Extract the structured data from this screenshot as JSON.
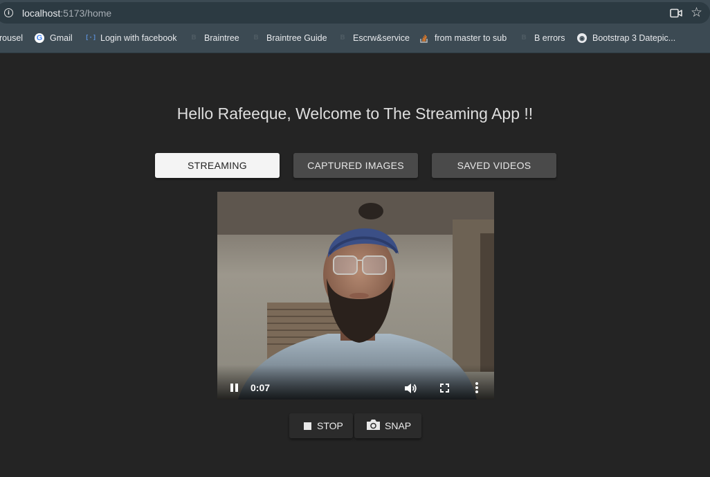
{
  "browser": {
    "url_host": "localhost",
    "url_path": ":5173/home",
    "bookmarks": [
      {
        "label": "rousel",
        "icon": "none"
      },
      {
        "label": "Gmail",
        "icon": "google-icon"
      },
      {
        "label": "Login with facebook",
        "icon": "code-bracket-icon"
      },
      {
        "label": "Braintree",
        "icon": "braintree-icon"
      },
      {
        "label": "Braintree Guide",
        "icon": "braintree-icon"
      },
      {
        "label": "Escrw&service",
        "icon": "braintree-icon"
      },
      {
        "label": "from master to sub",
        "icon": "stackoverflow-icon"
      },
      {
        "label": "B errors",
        "icon": "braintree-icon"
      },
      {
        "label": "Bootstrap 3 Datepic...",
        "icon": "globe-icon"
      }
    ]
  },
  "page": {
    "welcome": "Hello Rafeeque, Welcome to The Streaming App !!",
    "tabs": [
      {
        "label": "STREAMING",
        "active": true
      },
      {
        "label": "CAPTURED IMAGES",
        "active": false
      },
      {
        "label": "SAVED VIDEOS",
        "active": false
      }
    ],
    "video": {
      "time": "0:07"
    },
    "actions": {
      "stop_label": "STOP",
      "snap_label": "SNAP"
    }
  },
  "colors": {
    "background": "#242424",
    "chrome": "#3c4a53",
    "tab_active": "#f4f4f4",
    "tab_idle": "#4a4a4a"
  }
}
